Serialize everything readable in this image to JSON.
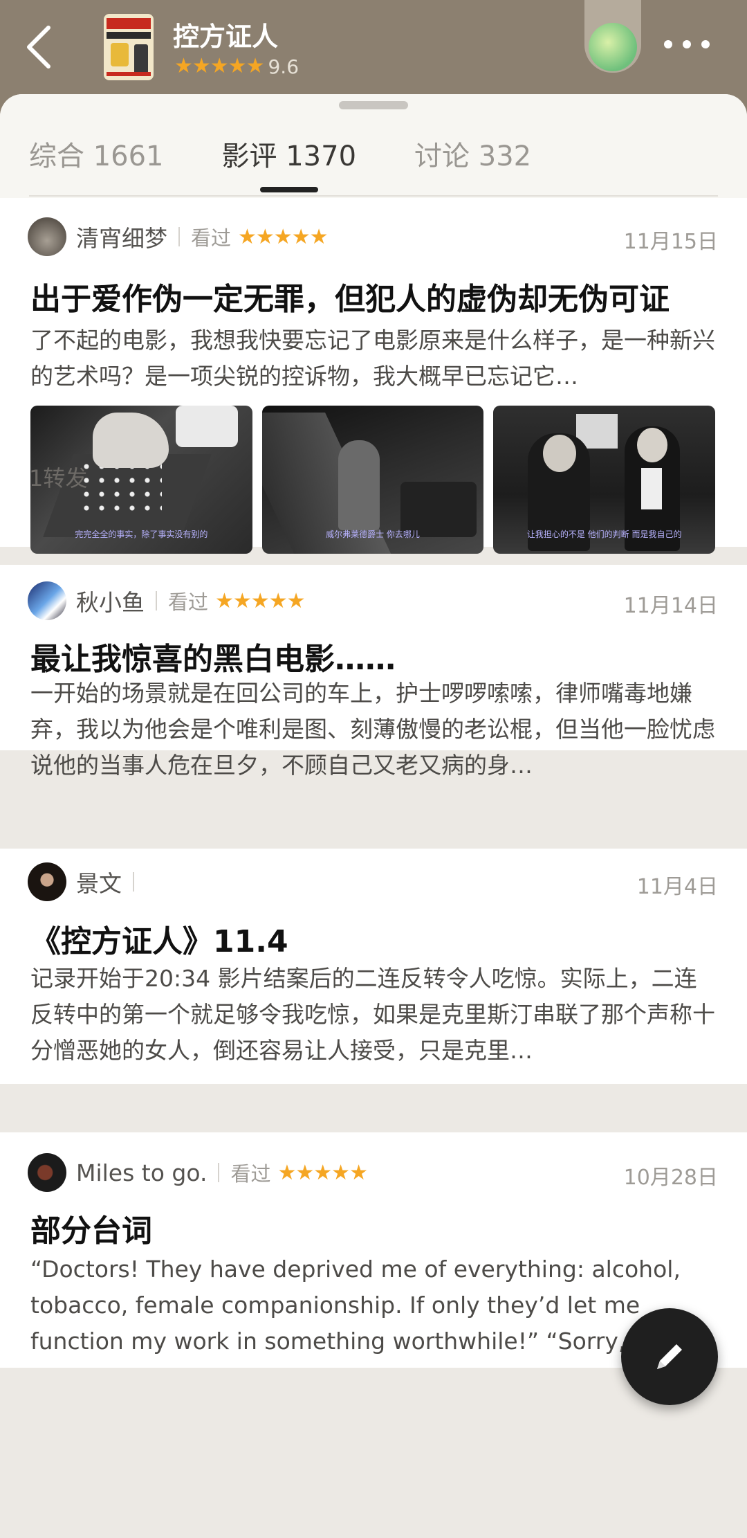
{
  "header": {
    "title": "控方证人",
    "rating": "9.6",
    "stars": "★★★★★",
    "back_icon": "chevron-left-icon",
    "more_icon": "more-dots-icon"
  },
  "tabs": [
    {
      "label": "综合 1661",
      "active": false
    },
    {
      "label": "影评 1370",
      "active": true
    },
    {
      "label": "讨论 332",
      "active": false
    }
  ],
  "reviews": [
    {
      "user": "清宵细梦",
      "seen": "看过",
      "stars": "★★★★★",
      "date": "11月15日",
      "title": "出于爱作伪一定无罪，但犯人的虚伪却无伪可证",
      "body": "了不起的电影，我想我快要忘记了电影原来是什么样子，是一种新兴的艺术吗？是一项尖锐的控诉物，我大概早已忘记它…",
      "images": [
        {
          "subtitle": "完完全全的事实，除了事实没有别的"
        },
        {
          "subtitle": "威尔弗莱德爵士  你去哪儿"
        },
        {
          "subtitle": "让我担心的不是  他们的判断  而是我自己的"
        }
      ],
      "repost": "1转发"
    },
    {
      "user": "秋小鱼",
      "seen": "看过",
      "stars": "★★★★★",
      "date": "11月14日",
      "title": "最让我惊喜的黑白电影……",
      "body": "一开始的场景就是在回公司的车上，护士啰啰嗦嗦，律师嘴毒地嫌弃，我以为他会是个唯利是图、刻薄傲慢的老讼棍，但当他一脸忧虑说他的当事人危在旦夕，不顾自己又老又病的身…"
    },
    {
      "user": "景文",
      "date": "11月4日",
      "title": "《控方证人》11.4",
      "body": "记录开始于20:34 影片结案后的二连反转令人吃惊。实际上，二连反转中的第一个就足够令我吃惊，如果是克里斯汀串联了那个声称十分憎恶她的女人，倒还容易让人接受，只是克里…"
    },
    {
      "user": "Miles to go.",
      "seen": "看过",
      "stars": "★★★★★",
      "date": "10月28日",
      "title": "部分台词",
      "body": "“Doctors! They have deprived me of everything: alcohol, tobacco, female companionship. If only they’d let me function my work in something worthwhile!” “Sorry, sir.” “…"
    }
  ],
  "fab": {
    "icon": "pencil-icon"
  }
}
